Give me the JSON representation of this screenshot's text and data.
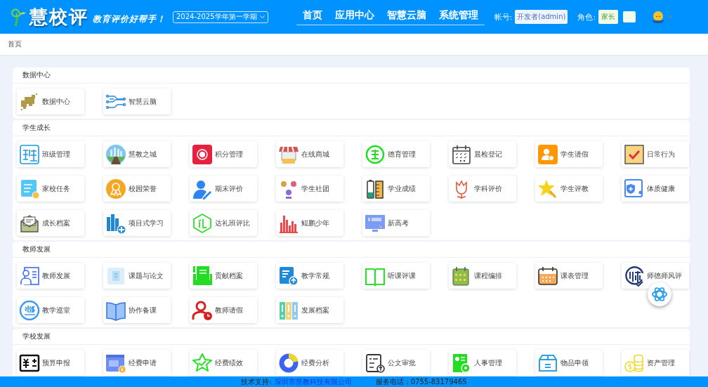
{
  "header": {
    "logo_text": "慧校评",
    "slogan": "教育评价好帮手！",
    "semester": "2024-2025学年第一学期",
    "nav": [
      "首页",
      "应用中心",
      "智慧云脑",
      "系统管理"
    ],
    "account_label": "帐号:",
    "account": "开发者(admin)",
    "role_label": "角色:",
    "role": "家长"
  },
  "breadcrumb": "首页",
  "sections": [
    {
      "title": "数据中心",
      "tiles": [
        "数据中心",
        "智慧云脑"
      ]
    },
    {
      "title": "学生成长",
      "tiles": [
        "班级管理",
        "慧教之城",
        "积分管理",
        "在线商城",
        "德育管理",
        "晨检登记",
        "学生请假",
        "日常行为",
        "家校任务",
        "校园荣誉",
        "期末评价",
        "学生社团",
        "学业成绩",
        "学科评价",
        "学生评教",
        "体质健康",
        "成长档案",
        "项目式学习",
        "达礼班评比",
        "鲲鹏少年",
        "新高考"
      ]
    },
    {
      "title": "教师发展",
      "tiles": [
        "教师发展",
        "课题与论文",
        "贡献档案",
        "教学常规",
        "听课评课",
        "课程编排",
        "课表管理",
        "师德师风评",
        "教学巡堂",
        "协作备课",
        "教师请假",
        "发展档案"
      ]
    },
    {
      "title": "学校发展",
      "tiles": [
        "预算申报",
        "经费申请",
        "经费绩效",
        "经费分析",
        "公文审批",
        "人事管理",
        "物品申领",
        "资产管理"
      ]
    }
  ],
  "footer": {
    "support_label": "技术支持:",
    "company": "深圳市慧教科技有限公司",
    "phone": "服务电话：0755-83179465"
  }
}
